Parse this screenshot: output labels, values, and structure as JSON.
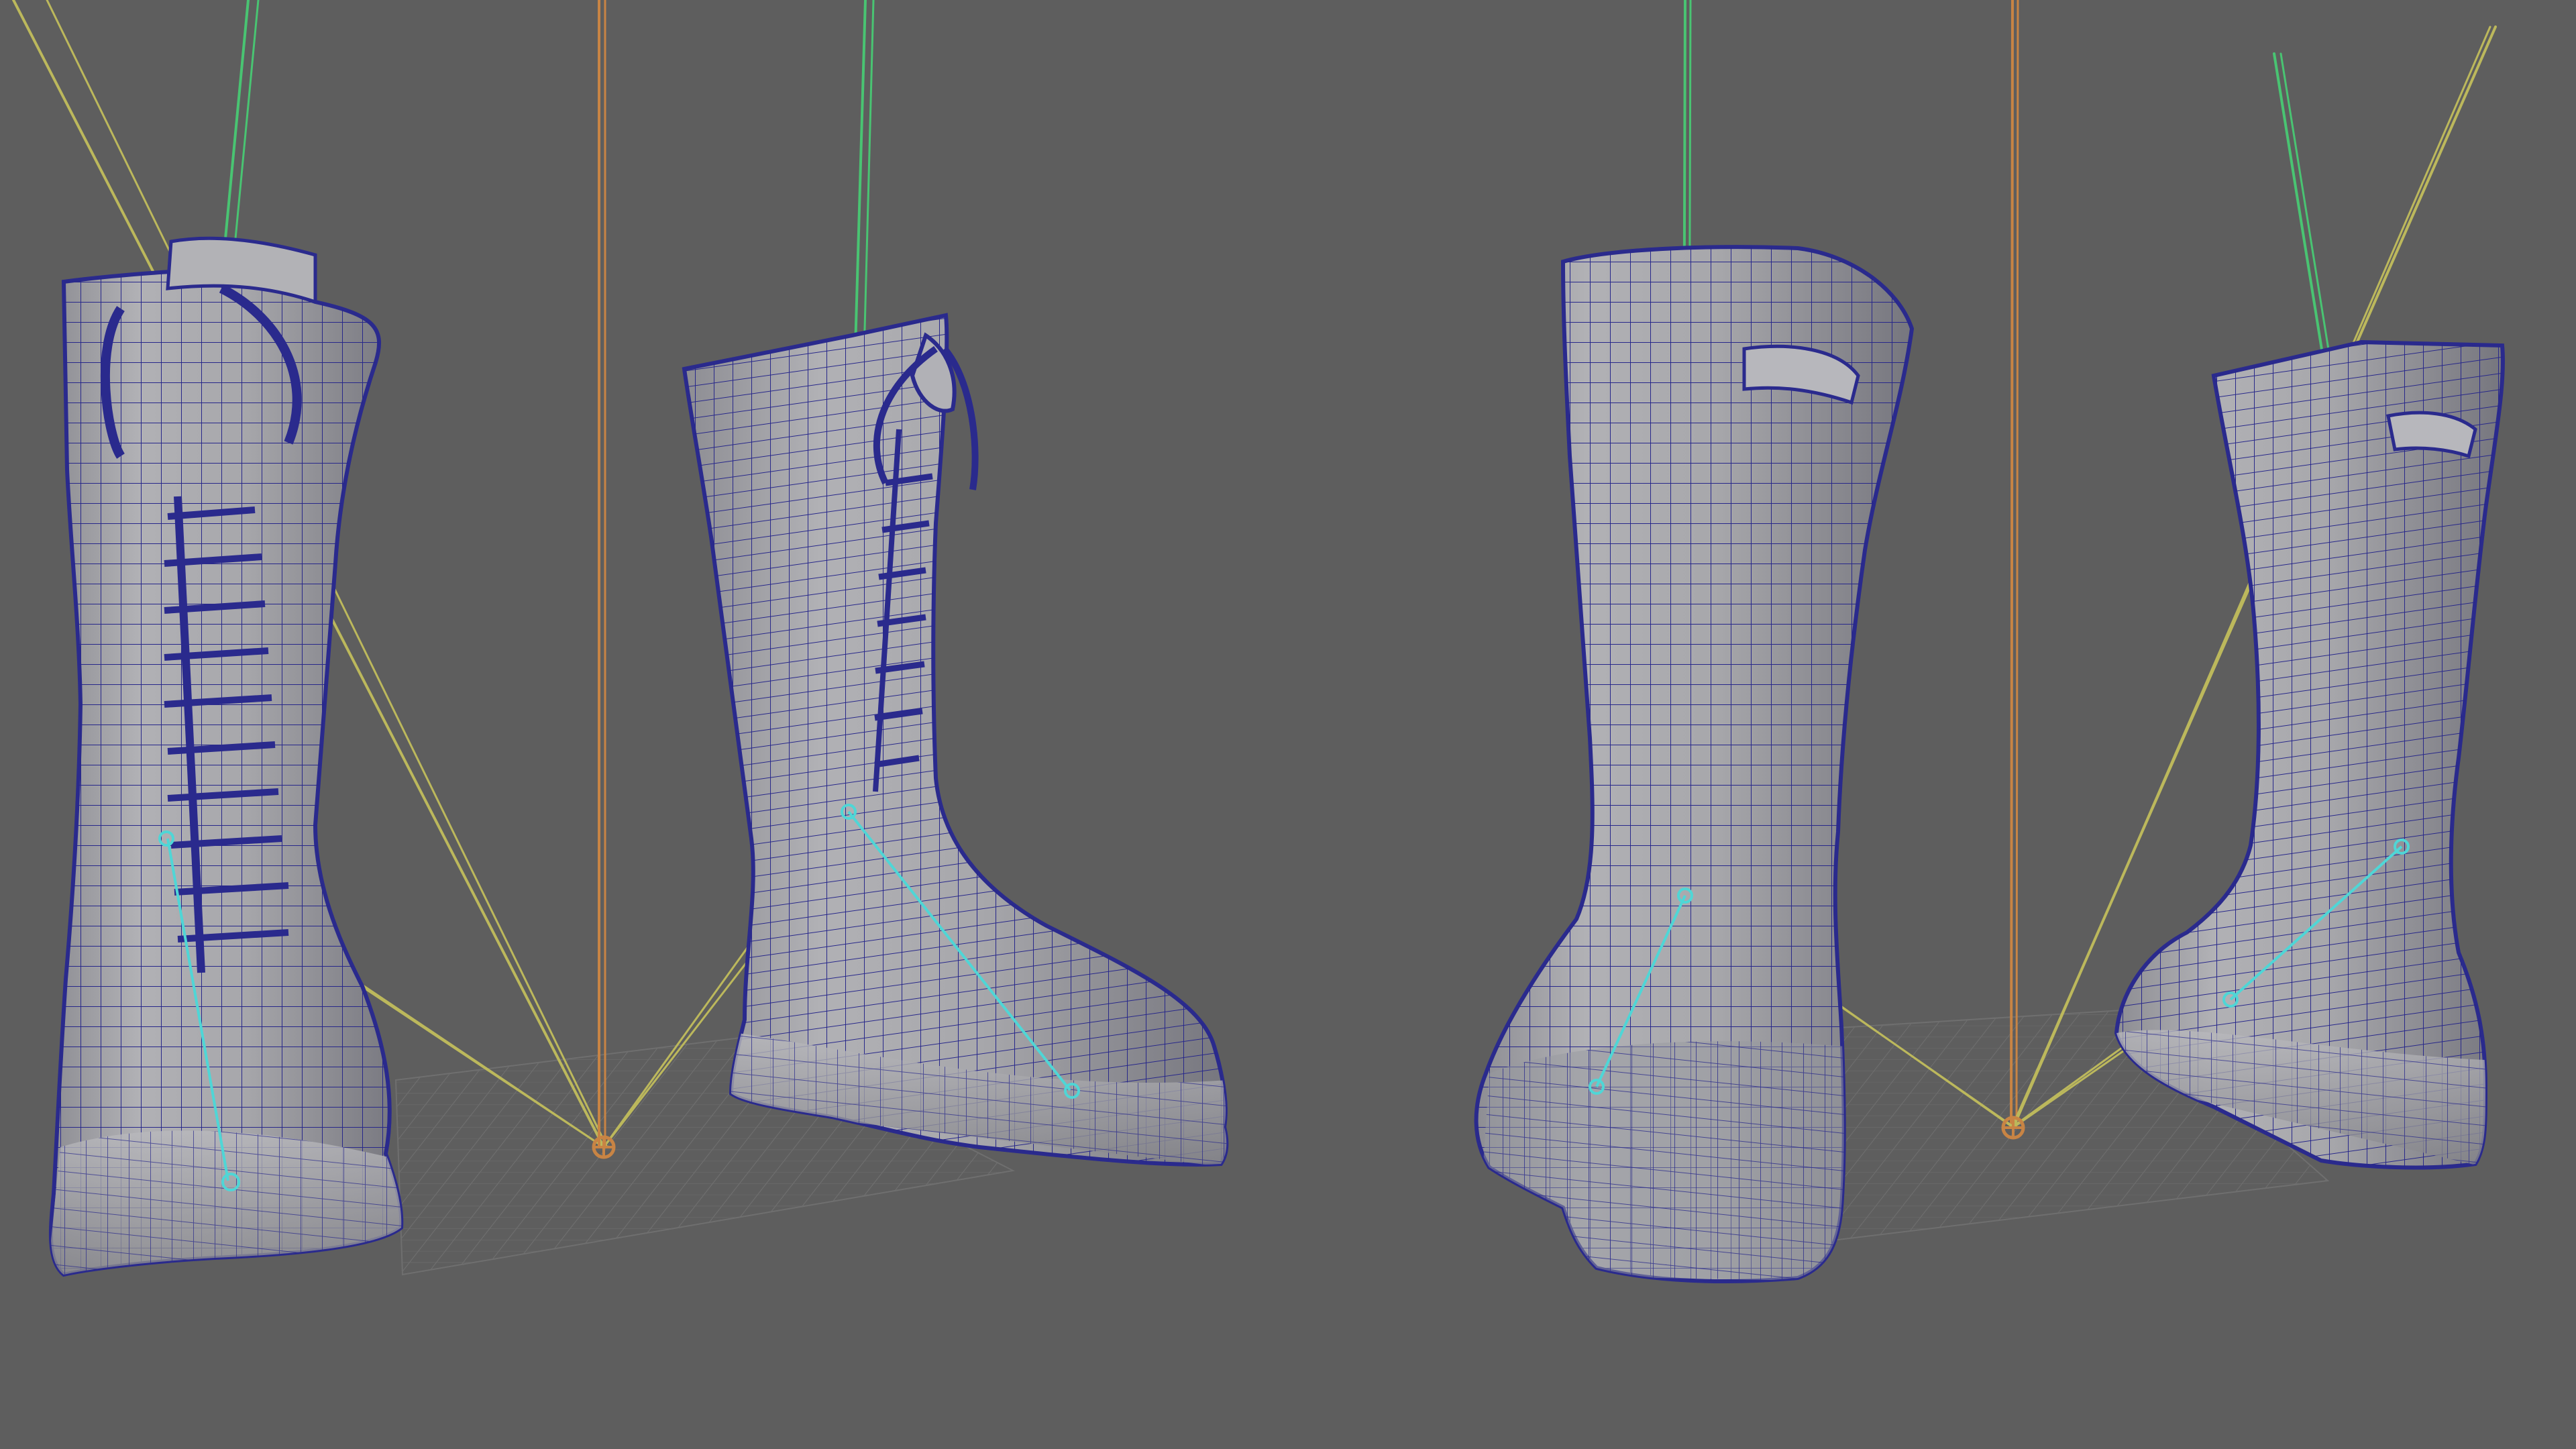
{
  "viewport": {
    "background_color": "#5e5e5e",
    "mesh_fill_color": "#a7a7ab",
    "mesh_shadow_color": "#77777f",
    "wireframe_color": "#27278a",
    "ground_grid_color": "#6f6f6f",
    "joint_color": "#4fd6d6",
    "rig_color_green": "#49c472",
    "rig_color_yellow": "#bcb85c",
    "rig_color_orange": "#c88444",
    "objects": [
      "left-boot-front-view",
      "left-boot-side-view",
      "right-boot-back-view",
      "right-boot-three-quarter-view"
    ]
  }
}
